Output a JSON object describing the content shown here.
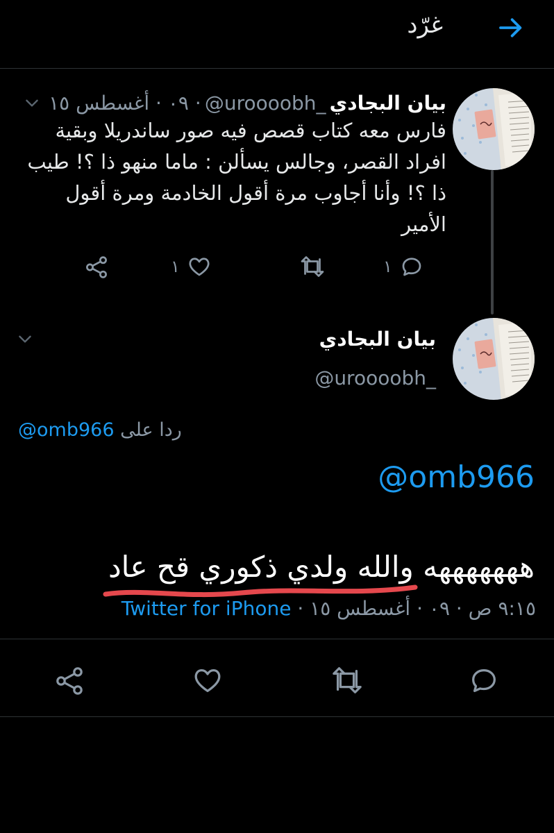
{
  "header": {
    "title": "غرّد"
  },
  "parent_tweet": {
    "name": "بيان البجادي",
    "handle": "@uroooobh_",
    "date": "٠٩ · أغسطس ١٥",
    "lines": [
      "فارس معه كتاب قصص فيه صور ساندريلا وبقية",
      "افراد القصر، وجالس يسألن : ماما منهو ذا ؟! طيب",
      "ذا ؟! وأنا أجاوب مرة أقول الخادمة ومرة أقول",
      "الأمير"
    ],
    "reply_count": "١",
    "like_count": "١"
  },
  "main_tweet": {
    "name": "بيان البجادي",
    "handle": "@uroooobh_",
    "replying_prefix": "ردا على",
    "replying_to": "@omb966",
    "mention": "@omb966",
    "text": "هههههههه والله ولدي ذكوري قح عاد",
    "time": "٩:١٥ ص · ٠٩ · أغسطس ١٥ ·",
    "source": "Twitter for iPhone"
  },
  "colors": {
    "background": "#000000",
    "accent": "#1d9bf0",
    "secondary_text": "#8b98a5",
    "underline": "#e5484d"
  },
  "icons": {
    "back": "arrow-right-icon",
    "reply": "speech-bubble-icon",
    "retweet": "retweet-icon",
    "like": "heart-icon",
    "share": "share-icon",
    "caret": "chevron-down-icon"
  }
}
